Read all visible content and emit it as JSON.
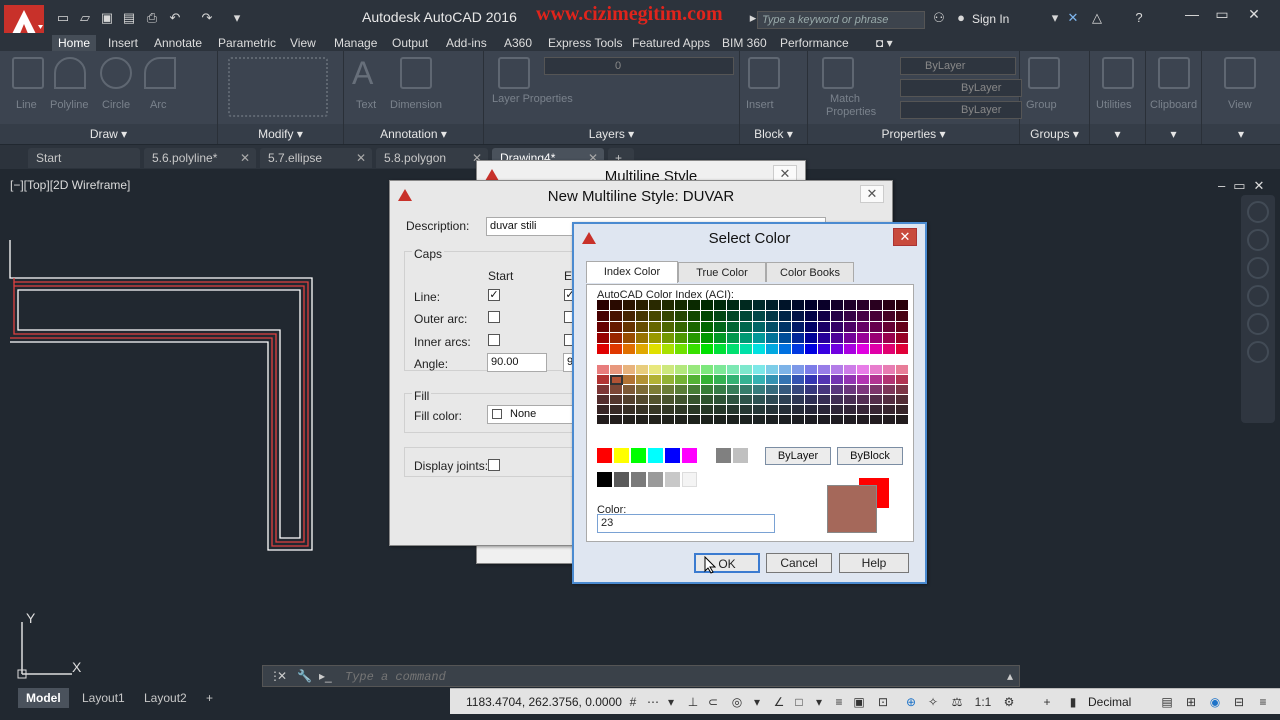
{
  "titlebar": {
    "app_title": "Autodesk AutoCAD 2016",
    "watermark": "www.cizimegitim.com",
    "search_placeholder": "Type a keyword or phrase",
    "sign_in": "Sign In"
  },
  "ribbon": {
    "tabs": [
      "Home",
      "Insert",
      "Annotate",
      "Parametric",
      "View",
      "Manage",
      "Output",
      "Add-ins",
      "A360",
      "Express Tools",
      "Featured Apps",
      "BIM 360",
      "Performance"
    ],
    "active_tab": "Home",
    "panels": {
      "draw": "Draw",
      "modify": "Modify",
      "annotation": "Annotation",
      "layers": "Layers",
      "block": "Block",
      "properties": "Properties",
      "groups": "Groups"
    },
    "tools": {
      "line": "Line",
      "polyline": "Polyline",
      "circle": "Circle",
      "arc": "Arc",
      "text": "Text",
      "dimension": "Dimension",
      "layer_properties": "Layer Properties",
      "insert": "Insert",
      "match_properties": "Match Properties",
      "group": "Group",
      "utilities": "Utilities",
      "clipboard": "Clipboard",
      "view": "View"
    },
    "layer_value": "0",
    "bylayer_1": "ByLayer",
    "bylayer_2": "ByLayer",
    "bylayer_3": "ByLayer"
  },
  "doc_tabs": [
    "Start",
    "5.6.polyline*",
    "5.7.ellipse",
    "5.8.polygon",
    "Drawing4*"
  ],
  "viewport_label": "[−][Top][2D Wireframe]",
  "multiline_style_dialog": {
    "title": "Multiline Style"
  },
  "new_ml_dialog": {
    "title": "New Multiline Style: DUVAR",
    "description_label": "Description:",
    "description_value": "duvar stili",
    "caps_label": "Caps",
    "start_label": "Start",
    "end_label": "En",
    "line_label": "Line:",
    "outer_arcs_label": "Outer arc:",
    "inner_arcs_label": "Inner arcs:",
    "angle_label": "Angle:",
    "angle_start": "90.00",
    "angle_end": "9(",
    "fill_label": "Fill",
    "fill_color_label": "Fill color:",
    "fill_color_value": "None",
    "display_joints_label": "Display joints:"
  },
  "select_color_dialog": {
    "title": "Select Color",
    "tabs": [
      "Index Color",
      "True Color",
      "Color Books"
    ],
    "aci_label": "AutoCAD Color Index (ACI):",
    "bylayer_button": "ByLayer",
    "byblock_button": "ByBlock",
    "color_label": "Color:",
    "color_value": "23",
    "ok": "OK",
    "cancel": "Cancel",
    "help": "Help"
  },
  "command_line": {
    "placeholder": "Type a command"
  },
  "layout_tabs": [
    "Model",
    "Layout1",
    "Layout2"
  ],
  "status": {
    "coords": "1183.4704, 262.3756, 0.0000",
    "scale": "1:1",
    "units": "Decimal"
  },
  "ucs": {
    "x": "X",
    "y": "Y"
  },
  "colors": {
    "accent": "#c8312a",
    "selected_color": "#a5685a",
    "previous_color": "#ff0000"
  }
}
